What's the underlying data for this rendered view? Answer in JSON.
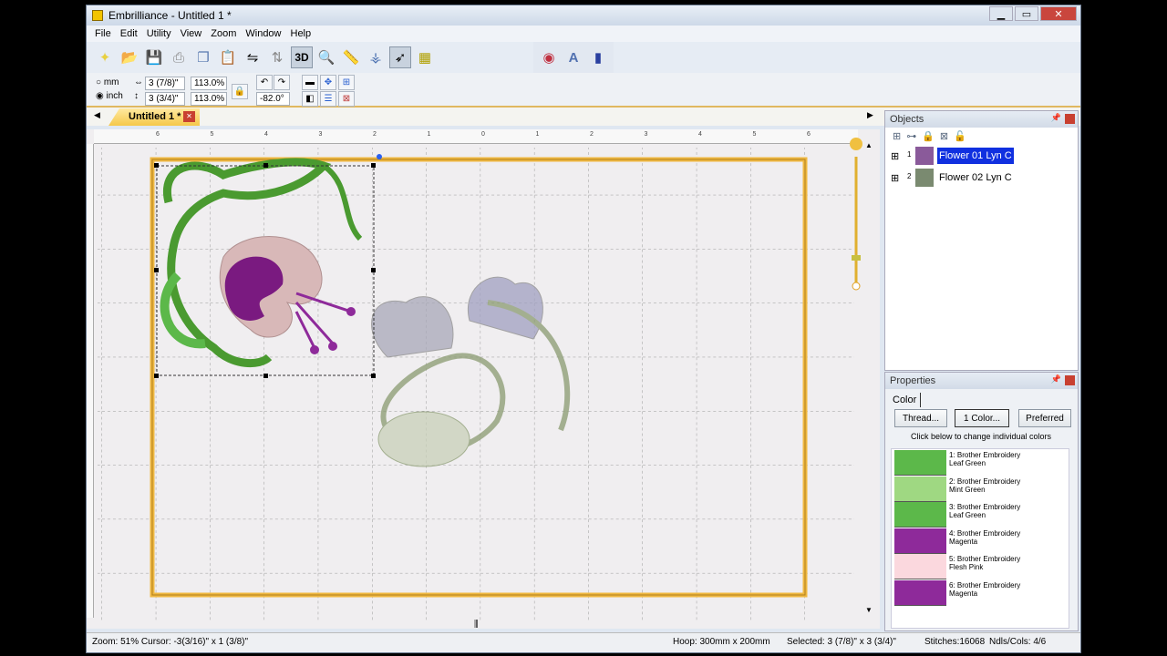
{
  "window": {
    "title": "Embrilliance - Untitled 1 *",
    "minimize": "▁",
    "maximize": "▭",
    "close": "✕"
  },
  "menu": [
    "File",
    "Edit",
    "Utility",
    "View",
    "Zoom",
    "Window",
    "Help"
  ],
  "toolbar": {
    "threed_label": "3D"
  },
  "options": {
    "unit_mm": "mm",
    "unit_inch": "inch",
    "unit_selected": "inch",
    "width": "3 (7/8)\"",
    "height": "3 (3/4)\"",
    "width_scale": "113.0%",
    "height_scale": "113.0%",
    "rotation": "-82.0°"
  },
  "tabs": [
    {
      "label": "Untitled 1 *",
      "active": true
    }
  ],
  "ruler": {
    "labels": [
      "6",
      "5",
      "4",
      "3",
      "2",
      "1",
      "0",
      "1",
      "2",
      "3",
      "4",
      "5",
      "6"
    ]
  },
  "objects": {
    "title": "Objects",
    "items": [
      {
        "index": "1",
        "name": "Flower 01 Lyn C",
        "selected": true
      },
      {
        "index": "2",
        "name": "Flower 02 Lyn C",
        "selected": false
      }
    ]
  },
  "properties": {
    "title": "Properties",
    "tab": "Color",
    "thread_button": "Thread...",
    "one_color_button": "1 Color...",
    "preferred_button": "Preferred",
    "hint": "Click below to change individual colors",
    "colors": [
      {
        "line1": "1: Brother Embroidery",
        "line2": "Leaf Green",
        "hex": "#5cb84a"
      },
      {
        "line1": "2: Brother Embroidery",
        "line2": "Mint Green",
        "hex": "#9fd882"
      },
      {
        "line1": "3: Brother Embroidery",
        "line2": "Leaf Green",
        "hex": "#5cb84a"
      },
      {
        "line1": "4: Brother Embroidery",
        "line2": "Magenta",
        "hex": "#8e2a9a"
      },
      {
        "line1": "5: Brother Embroidery",
        "line2": "Flesh Pink",
        "hex": "#fbd8de"
      },
      {
        "line1": "6: Brother Embroidery",
        "line2": "Magenta",
        "hex": "#8e2a9a"
      }
    ]
  },
  "status": {
    "zoom": "Zoom: 51%  Cursor: -3(3/16)\" x 1 (3/8)\"",
    "hoop": "Hoop: 300mm x 200mm",
    "selected": "Selected: 3 (7/8)\" x 3 (3/4)\"",
    "stitches": "Stitches:16068",
    "ndls": "Ndls/Cols: 4/6"
  },
  "accent": "#f0b840"
}
